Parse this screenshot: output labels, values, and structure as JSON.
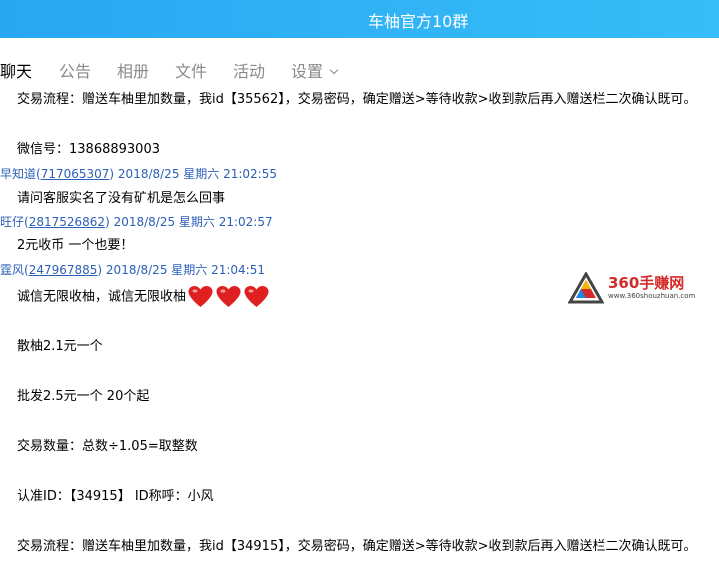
{
  "window": {
    "title": "车柚官方10群"
  },
  "tabs": [
    {
      "label": "聊天",
      "active": true
    },
    {
      "label": "公告"
    },
    {
      "label": "相册"
    },
    {
      "label": "文件"
    },
    {
      "label": "活动"
    },
    {
      "label": "设置"
    }
  ],
  "chat": {
    "messages": [
      {
        "text": "交易流程：赠送车柚里加数量，我id【35562】，交易密码，确定赠送>等待收款>收到款后再入赠送栏二次确认既可。"
      },
      {
        "text": "微信号：13868893003"
      },
      {
        "sender_name": "早知道",
        "sender_id": "717065307",
        "datetime": "2018/8/25 星期六 21:02:55"
      },
      {
        "text": "请问客服实名了没有矿机是怎么回事"
      },
      {
        "sender_name": "旺仔",
        "sender_id": "2817526862",
        "datetime": "2018/8/25 星期六 21:02:57"
      },
      {
        "text": "2元收币 一个也要！"
      },
      {
        "sender_name": "霆风",
        "sender_id": "247967885",
        "datetime": "2018/8/25 星期六 21:04:51"
      },
      {
        "text": "诚信无限收柚，诚信无限收柚"
      },
      {
        "text": "散柚2.1元一个"
      },
      {
        "text": "批发2.5元一个 20个起"
      },
      {
        "text": "交易数量：总数÷1.05=取整数"
      },
      {
        "text": "认准ID：【34915】     ID称呼：小风"
      },
      {
        "text": "交易流程：赠送车柚里加数量，我id【34915】，交易密码，确定赠送>等待收款>收到款后再入赠送栏二次确认既可。"
      }
    ]
  },
  "watermark": {
    "brand": "360手赚网",
    "url": "www.360shouzhuan.com"
  },
  "colors": {
    "titlebar": "#2eb0f5",
    "sender": "#2c5fb8",
    "heart": "#e02020"
  }
}
